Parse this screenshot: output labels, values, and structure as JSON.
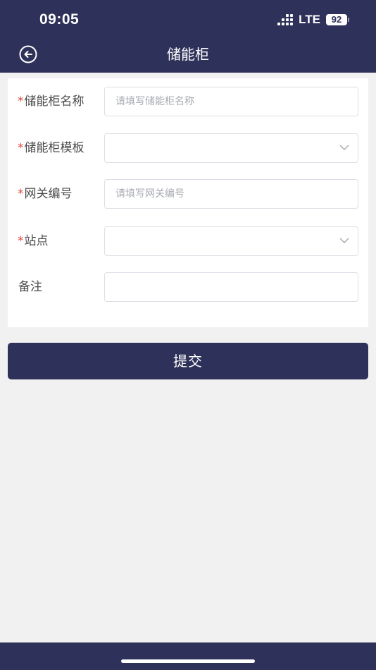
{
  "status_bar": {
    "time": "09:05",
    "network": "LTE",
    "battery": "92"
  },
  "nav": {
    "title": "储能柜",
    "back_icon": "back-arrow-circle-icon"
  },
  "form": {
    "fields": [
      {
        "required_mark": "*",
        "label": "储能柜名称",
        "placeholder": "请填写储能柜名称",
        "type": "text"
      },
      {
        "required_mark": "*",
        "label": "储能柜模板",
        "placeholder": "",
        "type": "select"
      },
      {
        "required_mark": "*",
        "label": "网关编号",
        "placeholder": "请填写网关编号",
        "type": "text"
      },
      {
        "required_mark": "*",
        "label": "站点",
        "placeholder": "",
        "type": "select"
      },
      {
        "required_mark": "",
        "label": "备注",
        "placeholder": "",
        "type": "text"
      }
    ]
  },
  "submit_label": "提交",
  "colors": {
    "primary": "#2e3159",
    "required": "#e0473c",
    "background": "#f1f1f1"
  }
}
